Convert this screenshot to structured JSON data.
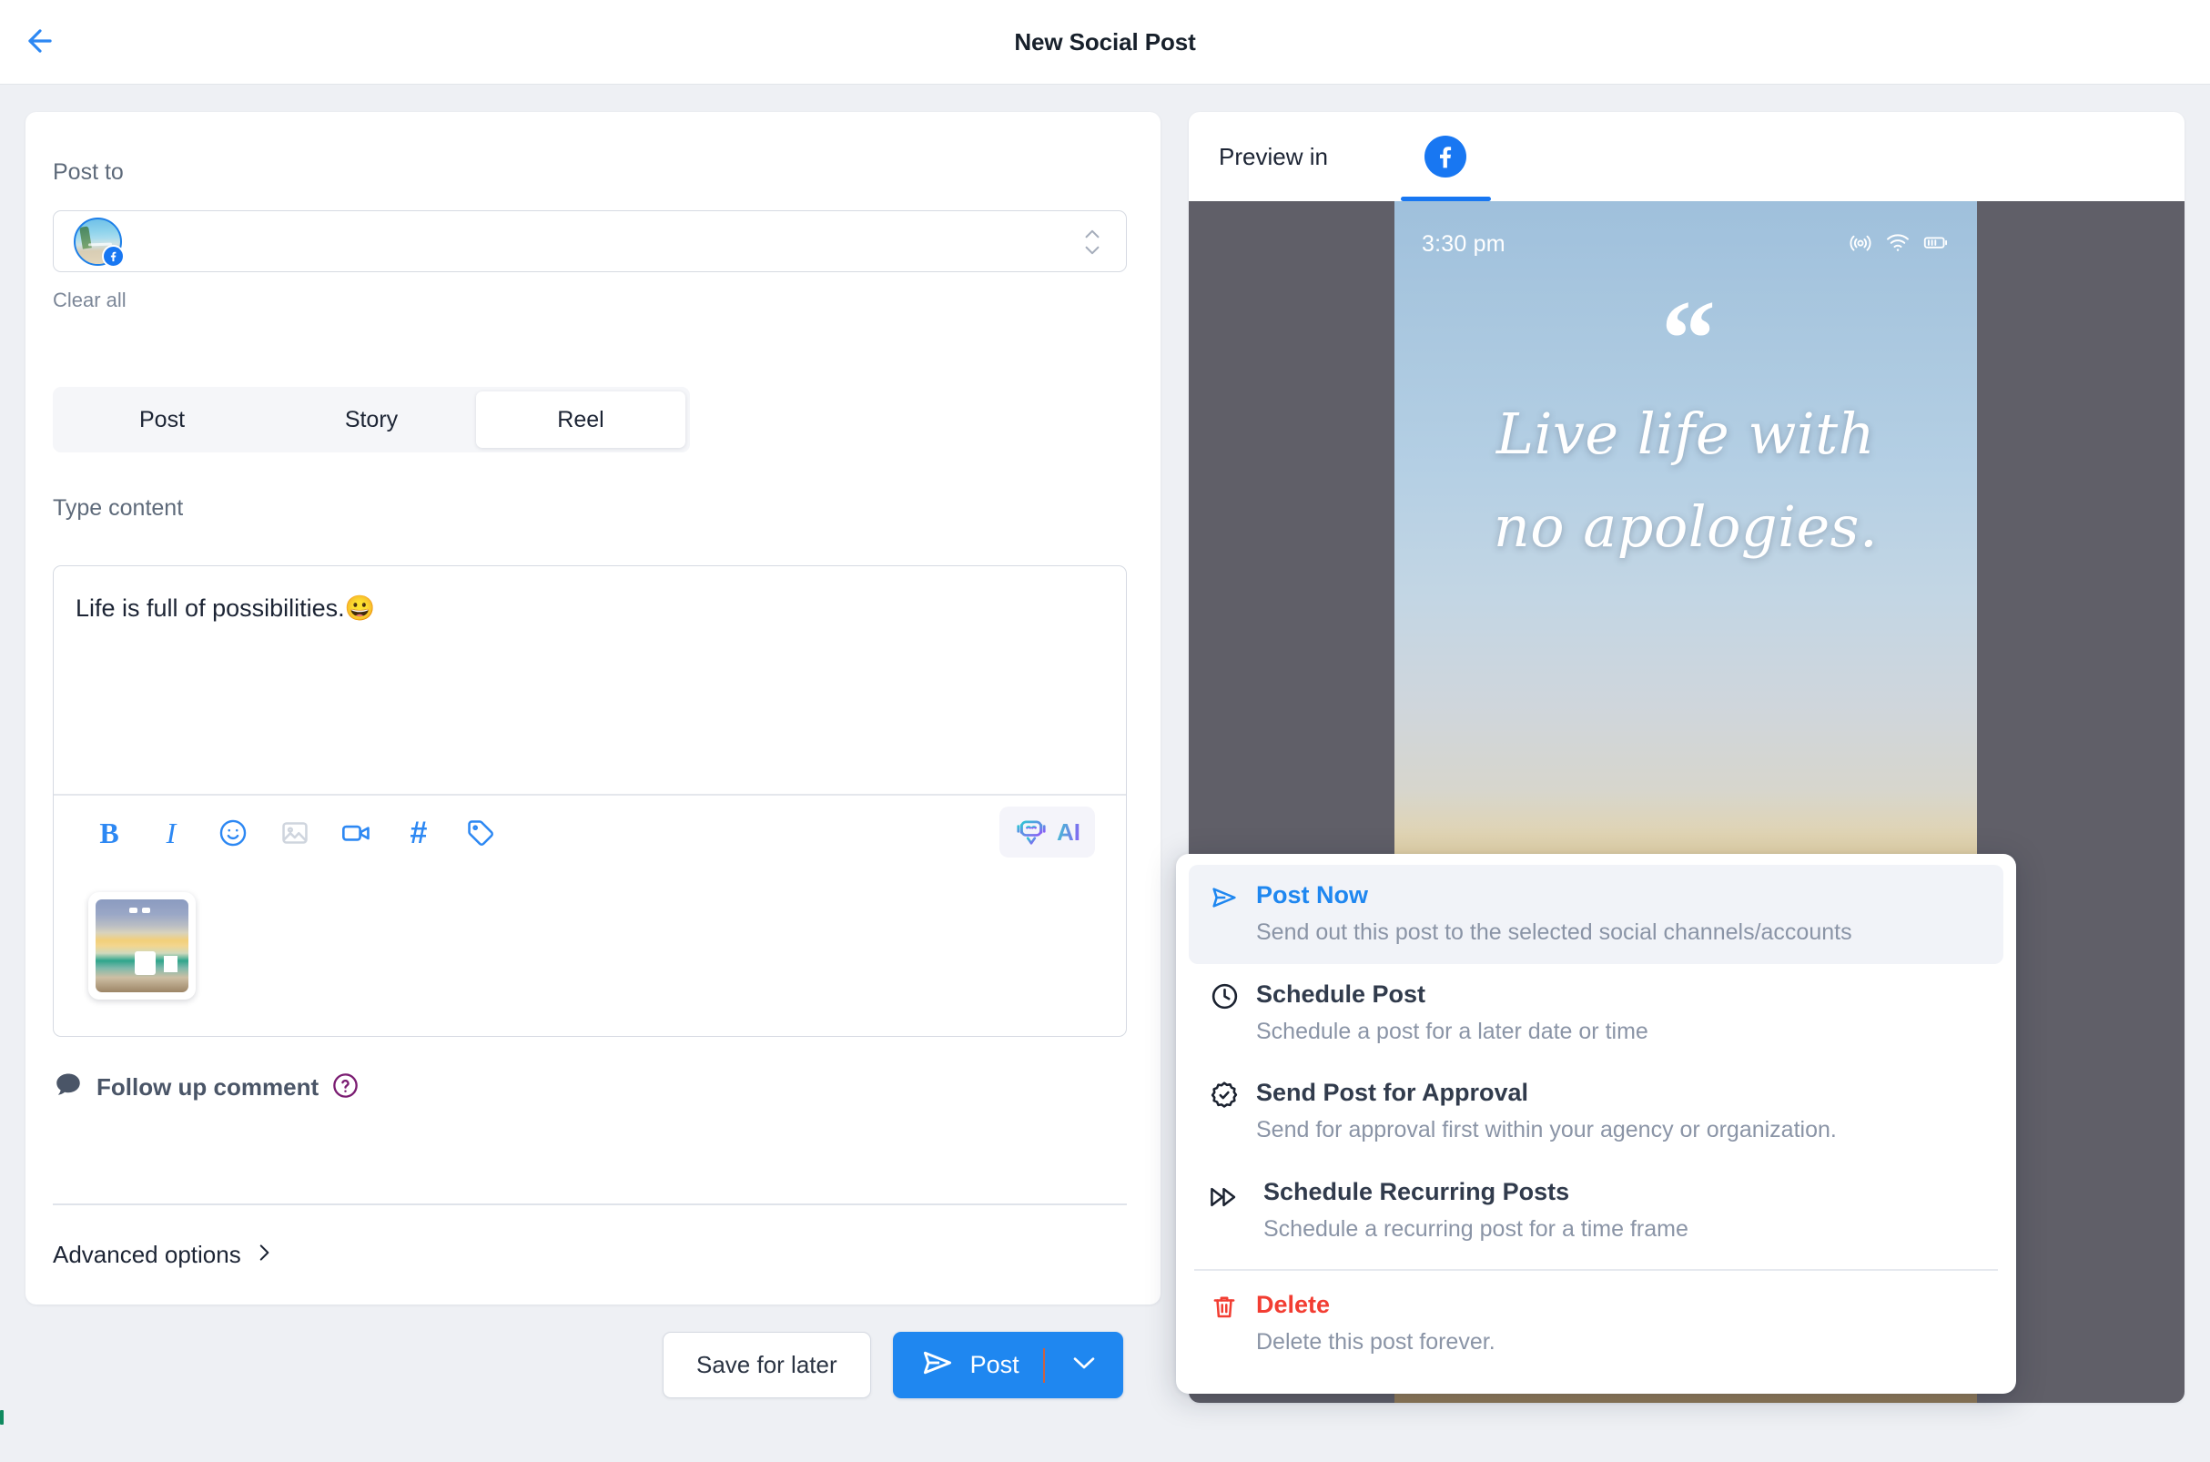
{
  "header": {
    "title": "New Social Post",
    "back_icon": "arrow-left-icon",
    "accent": "#2d88f3"
  },
  "compose": {
    "post_to_label": "Post to",
    "clear_all_label": "Clear all",
    "account": {
      "avatar_icon": "beach-avatar",
      "network_badge": "facebook-icon",
      "stepper_icon": "chevron-up-down-icon"
    },
    "segments": [
      {
        "label": "Post",
        "active": false
      },
      {
        "label": "Story",
        "active": false
      },
      {
        "label": "Reel",
        "active": true
      }
    ],
    "type_content_label": "Type content",
    "editor_text": "Life is full of possibilities.",
    "editor_emoji": "😀",
    "toolbar": [
      {
        "name": "bold-icon",
        "label": "B",
        "disabled": false
      },
      {
        "name": "italic-icon",
        "label": "I",
        "disabled": false
      },
      {
        "name": "emoji-icon",
        "label": "",
        "disabled": false
      },
      {
        "name": "image-icon",
        "label": "",
        "disabled": true
      },
      {
        "name": "video-icon",
        "label": "",
        "disabled": false
      },
      {
        "name": "hashtag-icon",
        "label": "#",
        "disabled": false
      },
      {
        "name": "tag-icon",
        "label": "",
        "disabled": false
      }
    ],
    "ai_button": {
      "label": "AI",
      "icon": "robot-icon"
    },
    "attachment": {
      "icon": "beach-sunset-thumbnail"
    },
    "followup": {
      "label": "Follow up comment",
      "icon": "comment-bubble-icon",
      "help_icon": "question-mark-icon"
    },
    "advanced_options": {
      "label": "Advanced options",
      "icon": "chevron-right-icon"
    }
  },
  "footer": {
    "save_label": "Save for later",
    "post_label": "Post",
    "post_icon": "send-icon",
    "caret_icon": "chevron-down-icon",
    "post_color": "#1f87f0"
  },
  "preview": {
    "label": "Preview in",
    "tabs": [
      {
        "name": "facebook-icon",
        "active": true
      }
    ],
    "phone": {
      "time": "3:30 pm",
      "status_icons": [
        "cellular-icon",
        "wifi-icon",
        "battery-icon"
      ],
      "quote_mark": "“",
      "quote_line_1": "Live life with",
      "quote_line_2": "no apologies."
    }
  },
  "menu": {
    "items": [
      {
        "title": "Post Now",
        "desc": "Send out this post to the selected social channels/accounts",
        "icon": "send-icon",
        "style": "accent",
        "highlight": true
      },
      {
        "title": "Schedule Post",
        "desc": "Schedule a post for a later date or time",
        "icon": "clock-icon",
        "style": "default",
        "highlight": false
      },
      {
        "title": "Send Post for Approval",
        "desc": "Send for approval first within your agency or organization.",
        "icon": "badge-check-icon",
        "style": "default",
        "highlight": false
      },
      {
        "title": "Schedule Recurring Posts",
        "desc": "Schedule a recurring post for a time frame",
        "icon": "fast-forward-icon",
        "style": "default",
        "highlight": false
      },
      {
        "title": "Delete",
        "desc": "Delete this post forever.",
        "icon": "trash-icon",
        "style": "danger",
        "highlight": false
      }
    ]
  }
}
